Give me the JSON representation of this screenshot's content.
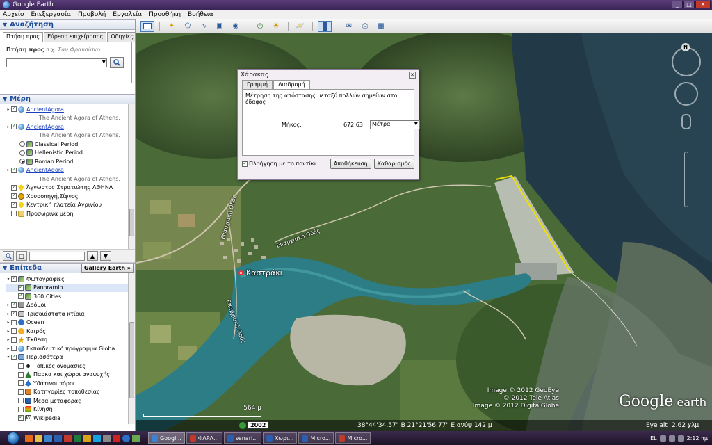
{
  "window": {
    "title": "Google Earth",
    "min": "_",
    "max": "□",
    "close": "✕"
  },
  "menu": [
    "Αρχείο",
    "Επεξεργασία",
    "Προβολή",
    "Εργαλεία",
    "Προσθήκη",
    "Βοήθεια"
  ],
  "search": {
    "header": "Αναζήτηση",
    "tabs": [
      "Πτήση προς",
      "Εύρεση επιχείρησης",
      "Οδηγίες"
    ],
    "label": "Πτήση προς",
    "hint": "π.χ. Σαν Φρανσίσκο",
    "value": ""
  },
  "places": {
    "header": "Μέρη",
    "items": [
      {
        "type": "link",
        "label": "AncientAgora",
        "checked": true
      },
      {
        "type": "desc",
        "label": "The Ancient Agora of Athens."
      },
      {
        "type": "link",
        "label": "AncientAgora",
        "checked": true
      },
      {
        "type": "desc",
        "label": "The Ancient Agora of Athens."
      },
      {
        "type": "radio",
        "label": "Classical Period",
        "on": false
      },
      {
        "type": "radio",
        "label": "Hellenistic Period",
        "on": false
      },
      {
        "type": "radio",
        "label": "Roman Period",
        "on": true
      },
      {
        "type": "link",
        "label": "AncientAgora",
        "checked": true
      },
      {
        "type": "desc",
        "label": "The Ancient Agora of Athens."
      },
      {
        "type": "pin",
        "label": "Άγνωστος Στρατιώτης ΑΘΗΝΑ",
        "checked": true
      },
      {
        "type": "circle",
        "label": "Χρυσοπηγή,Σίφνος",
        "checked": true
      },
      {
        "type": "pin",
        "label": "Κεντρική πλατεία Αγρινίου",
        "checked": true
      },
      {
        "type": "folder",
        "label": "Προσωρινά μέρη",
        "checked": false
      }
    ]
  },
  "layers": {
    "header": "Επίπεδα",
    "gallery": "Gallery Earth",
    "items": [
      {
        "label": "Φωτογραφίες",
        "icon": "img",
        "checked": true,
        "indent": 1
      },
      {
        "label": "Panoramio",
        "icon": "img",
        "checked": true,
        "indent": 2,
        "selected": true
      },
      {
        "label": "360 Cities",
        "icon": "img",
        "checked": true,
        "indent": 2
      },
      {
        "label": "Δρόμοι",
        "icon": "road",
        "checked": true,
        "indent": 1
      },
      {
        "label": "Τρισδιάστατα κτίρια",
        "icon": "bld",
        "checked": true,
        "indent": 1
      },
      {
        "label": "Ocean",
        "icon": "ocean",
        "checked": false,
        "indent": 1
      },
      {
        "label": "Καιρός",
        "icon": "sun",
        "checked": false,
        "indent": 1
      },
      {
        "label": "Έκθεση",
        "icon": "star",
        "checked": false,
        "indent": 1
      },
      {
        "label": "Εκπαιδευτικό πρόγραμμα Globa...",
        "icon": "globe",
        "checked": false,
        "indent": 1
      },
      {
        "label": "Περισσότερα",
        "icon": "more",
        "checked": true,
        "indent": 1
      },
      {
        "label": "Τοπικές ονομασίες",
        "icon": "dot",
        "checked": false,
        "indent": 2
      },
      {
        "label": "Παρκα και χώροι αναψυχής",
        "icon": "tree",
        "checked": false,
        "indent": 2
      },
      {
        "label": "Υδάτινοι πόροι",
        "icon": "water",
        "checked": false,
        "indent": 2
      },
      {
        "label": "Κατηγορίες τοποθεσίας",
        "icon": "tag",
        "checked": false,
        "indent": 2
      },
      {
        "label": "Μέσα μεταφοράς",
        "icon": "bus",
        "checked": false,
        "indent": 2
      },
      {
        "label": "Κίνηση",
        "icon": "traffic",
        "checked": false,
        "indent": 2
      },
      {
        "label": "Wikipedia",
        "icon": "wiki",
        "checked": true,
        "indent": 2
      }
    ]
  },
  "ruler": {
    "title": "Χάρακας",
    "tabs": [
      "Γραμμή",
      "Διαδρομή"
    ],
    "description": "Μέτρηση της απόστασης μεταξύ πολλών σημείων στο έδαφος",
    "length_label": "Μήκος:",
    "length_value": "672,63",
    "unit": "Μέτρα",
    "mouse_nav": "Πλοήγηση με το ποντίκι",
    "save": "Αποθήκευση",
    "clear": "Καθαρισμός"
  },
  "map": {
    "place": "Καστράκι",
    "road_label_1": "Επαρχιακή Οδός",
    "road_label_2": "Επαρχιακή Οδός",
    "road_label_3": "Επαρχιακή Οδός",
    "credits": [
      "Image © 2012 GeoEye",
      "© 2012 Tele Atlas",
      "Image © 2012 DigitalGlobe"
    ],
    "logo_main": "Google",
    "logo_sub": "earth",
    "north": "N",
    "scale": "564 μ",
    "year": "2002",
    "coords": "38°44'34.57\" Β  21°21'56.77\" Ε  ανύψ  142 μ",
    "eye_alt_label": "Eye alt",
    "eye_alt_value": "2.62 χλμ"
  },
  "taskbar": {
    "tasks": [
      {
        "label": "Googl...",
        "color": "#3b82d0",
        "active": true
      },
      {
        "label": "ΦΑΡΑ...",
        "color": "#c0392b"
      },
      {
        "label": "senari...",
        "color": "#2b5fae"
      },
      {
        "label": "Χωρι...",
        "color": "#2b5fae"
      },
      {
        "label": "Micro...",
        "color": "#2b5fae"
      },
      {
        "label": "Micro...",
        "color": "#c0392b"
      }
    ],
    "lang": "EL",
    "time": "2:12 πμ"
  }
}
